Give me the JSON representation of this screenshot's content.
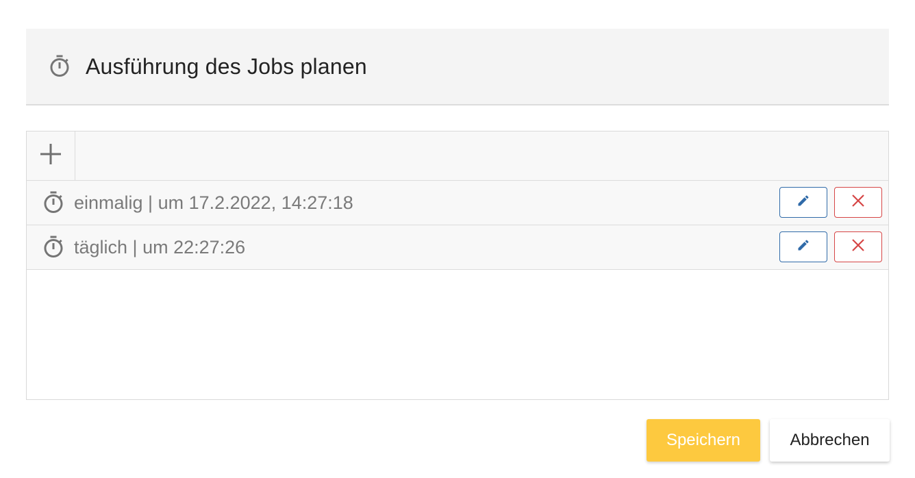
{
  "dialog": {
    "title": "Ausführung des Jobs planen",
    "title_icon": "stopwatch-icon"
  },
  "toolbar": {
    "add_icon": "plus-icon"
  },
  "schedules": [
    {
      "icon": "stopwatch-icon",
      "text": "einmalig | um 17.2.2022, 14:27:18",
      "edit_icon": "pencil-icon",
      "delete_icon": "close-icon"
    },
    {
      "icon": "stopwatch-icon",
      "text": "täglich | um 22:27:26",
      "edit_icon": "pencil-icon",
      "delete_icon": "close-icon"
    }
  ],
  "footer": {
    "save_label": "Speichern",
    "cancel_label": "Abbrechen"
  },
  "colors": {
    "header_bg": "#f4f4f4",
    "edit_accent": "#2f6aa8",
    "delete_accent": "#d64545",
    "save_bg": "#fdc93f",
    "icon_gray": "#7a7a7a"
  }
}
